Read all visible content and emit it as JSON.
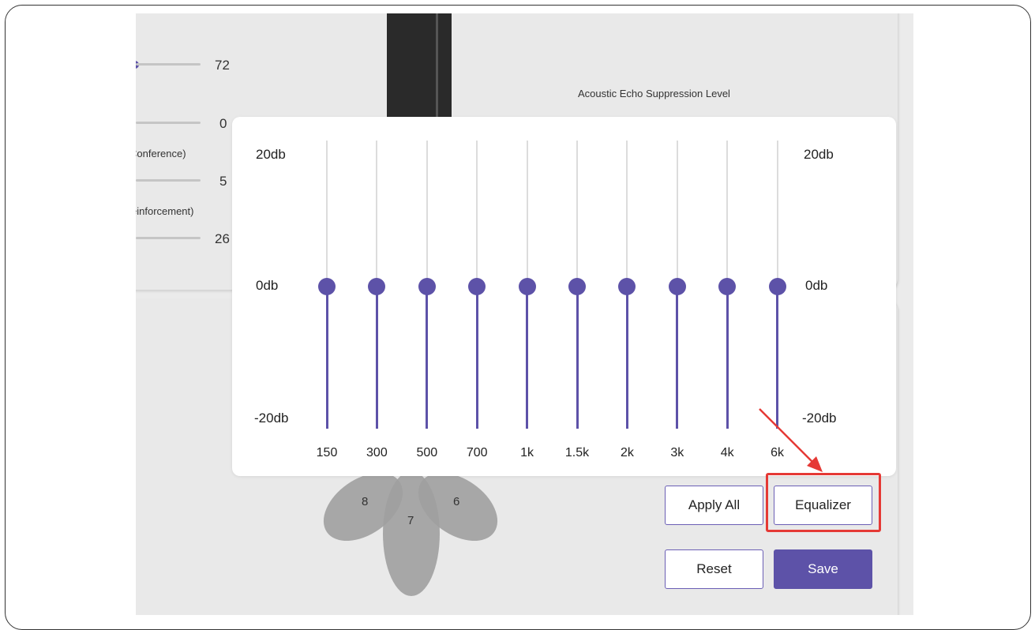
{
  "background_panel": {
    "sliders": [
      {
        "value": "72",
        "label": ""
      },
      {
        "value": "0",
        "label": "Conference)"
      },
      {
        "value": "5",
        "label": "einforcement)"
      },
      {
        "value": "26",
        "label": ""
      }
    ],
    "aes_label": "Acoustic Echo Suppression Level",
    "petals": [
      "8",
      "7",
      "6"
    ]
  },
  "equalizer": {
    "db_top": "20db",
    "db_mid": "0db",
    "db_bottom": "-20db",
    "bands": [
      {
        "freq": "150",
        "gain_db": 0
      },
      {
        "freq": "300",
        "gain_db": 0
      },
      {
        "freq": "500",
        "gain_db": 0
      },
      {
        "freq": "700",
        "gain_db": 0
      },
      {
        "freq": "1k",
        "gain_db": 0
      },
      {
        "freq": "1.5k",
        "gain_db": 0
      },
      {
        "freq": "2k",
        "gain_db": 0
      },
      {
        "freq": "3k",
        "gain_db": 0
      },
      {
        "freq": "4k",
        "gain_db": 0
      },
      {
        "freq": "6k",
        "gain_db": 0
      }
    ],
    "range_db": [
      -20,
      20
    ]
  },
  "buttons": {
    "apply_all": "Apply All",
    "equalizer": "Equalizer",
    "reset": "Reset",
    "save": "Save"
  },
  "colors": {
    "accent": "#5d52a8",
    "highlight": "#e53935"
  },
  "annotation": {
    "arrow_target": "equalizer-button"
  }
}
